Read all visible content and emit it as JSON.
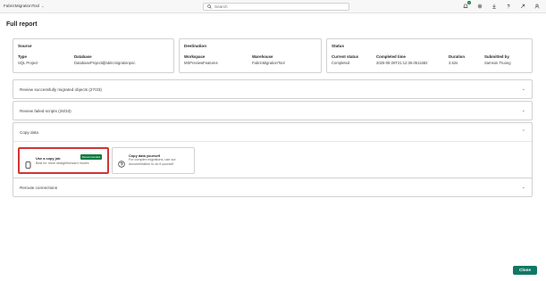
{
  "topbar": {
    "app_name": "FabricMigrationTool",
    "search_placeholder": "Search",
    "notification_count": "1"
  },
  "page_title": "Full report",
  "source": {
    "title": "Source",
    "type_label": "Type",
    "type_value": "SQL Project",
    "database_label": "Database",
    "database_value": "DatabaseProjectdjfabricmigrationpoc"
  },
  "destination": {
    "title": "Destination",
    "workspace_label": "Workspace",
    "workspace_value": "MSPreviewFeatures",
    "warehouse_label": "Warehouse",
    "warehouse_value": "FabricMigrationTool"
  },
  "status": {
    "title": "Status",
    "current_status_label": "Current status",
    "current_status_value": "Completed",
    "completed_time_label": "Completed time",
    "completed_time_value": "2025-05-28T21:12:39.0511682",
    "duration_label": "Duration",
    "duration_value": "3.52s",
    "submitted_by_label": "Submitted by",
    "submitted_by_value": "Samson Truong"
  },
  "sections": {
    "migrated": "Review successfully migrated objects (27/33)",
    "failed": "Review failed scripts (26/33)",
    "copy_data": "Copy data",
    "reroute": "Reroute connections"
  },
  "copy_options": {
    "copy_job_title": "Use a copy job",
    "copy_job_desc": "Best for more straightforward moves",
    "recommended_badge": "Recommended",
    "self_title": "Copy data yourself",
    "self_desc": "For complex migrations, use our documentation to do it yourself"
  },
  "close_label": "Close",
  "colors": {
    "accent": "#117865",
    "badge_green": "#0f7b3f",
    "highlight_red": "#d13438"
  }
}
